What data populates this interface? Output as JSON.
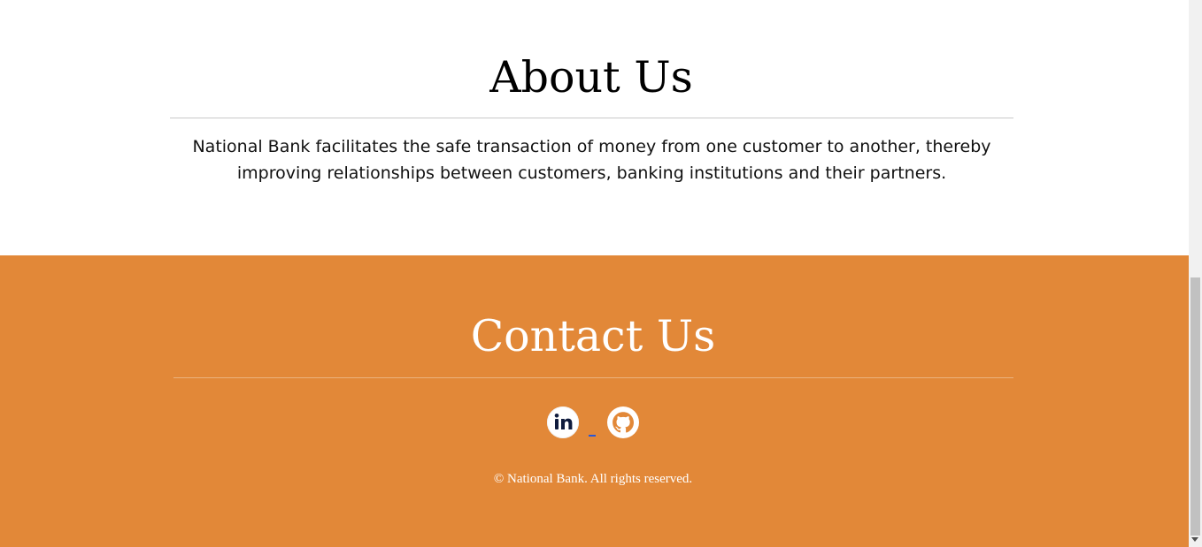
{
  "about": {
    "title": "About Us",
    "text": "National Bank facilitates the safe transaction of money from one customer to another, thereby improving relationships between customers, banking institutions and their partners."
  },
  "contact": {
    "title": "Contact Us",
    "links": [
      {
        "icon": "linkedin-icon",
        "label": "LinkedIn"
      },
      {
        "icon": "github-icon",
        "label": "GitHub"
      }
    ],
    "copyright": "© National Bank. All rights reserved."
  },
  "colors": {
    "footer_background": "#e28838",
    "text_dark": "#111111",
    "link_underline": "#2757d8",
    "scrollbar_thumb": "#c1c1c1"
  }
}
